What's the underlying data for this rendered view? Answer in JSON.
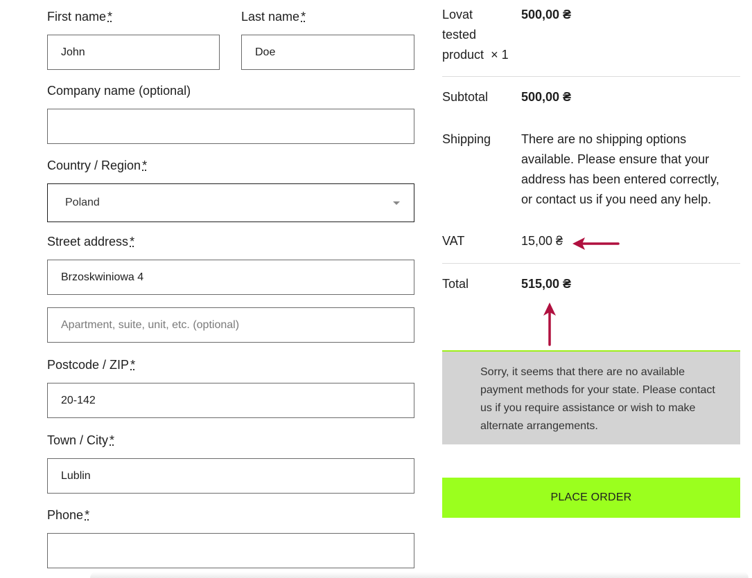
{
  "billing": {
    "first_name": {
      "label": "First name",
      "required": "*",
      "value": "John"
    },
    "last_name": {
      "label": "Last name",
      "required": "*",
      "value": "Doe"
    },
    "company": {
      "label": "Company name (optional)",
      "value": ""
    },
    "country": {
      "label": "Country / Region",
      "required": "*",
      "value": "Poland"
    },
    "street": {
      "label": "Street address",
      "required": "*",
      "value": "Brzoskwiniowa 4"
    },
    "apartment": {
      "placeholder": "Apartment, suite, unit, etc. (optional)",
      "value": ""
    },
    "postcode": {
      "label": "Postcode / ZIP",
      "required": "*",
      "value": "20-142"
    },
    "city": {
      "label": "Town / City",
      "required": "*",
      "value": "Lublin"
    },
    "phone": {
      "label": "Phone",
      "required": "*",
      "value": ""
    }
  },
  "order": {
    "product": {
      "line1": "Lovat",
      "line2": "tested",
      "line3": "product",
      "qty": "× 1",
      "price": "500,00 ₴"
    },
    "subtotal": {
      "label": "Subtotal",
      "value": "500,00 ₴"
    },
    "shipping": {
      "label": "Shipping",
      "line1": "There are no shipping options",
      "line2": "available. Please ensure that your",
      "line3": "address has been entered correctly,",
      "line4": "or contact us if you need any help."
    },
    "vat": {
      "label": "VAT",
      "value": "15,00 ₴"
    },
    "total": {
      "label": "Total",
      "value": "515,00 ₴"
    }
  },
  "payment_notice": {
    "line1": "Sorry, it seems that there are no available",
    "line2": "payment methods for your state. Please contact",
    "line3": "us if you require assistance or wish to make",
    "line4": "alternate arrangements."
  },
  "place_order_label": "PLACE ORDER",
  "colors": {
    "annotation_arrow": "#b0103f",
    "place_order_bg": "#9bff1e",
    "notice_bg": "#d3d3d3"
  }
}
